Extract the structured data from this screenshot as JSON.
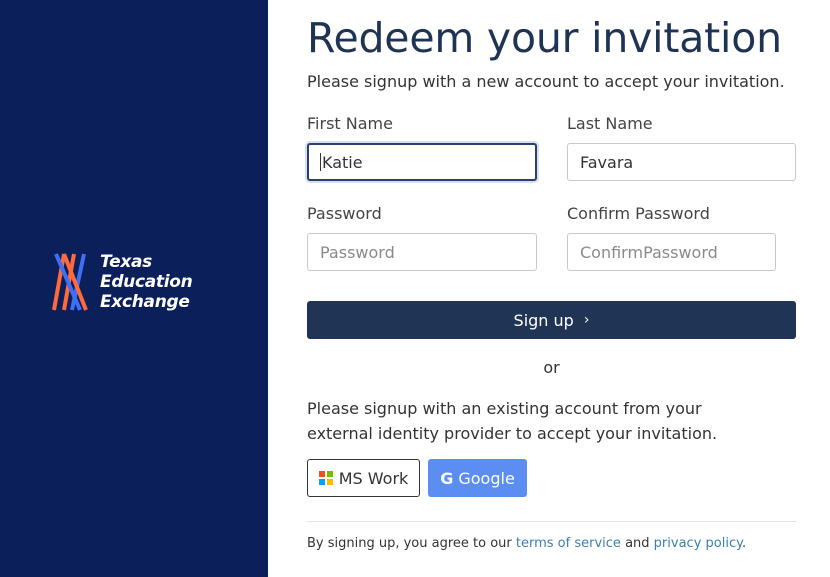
{
  "brand": {
    "line1": "Texas",
    "line2": "Education",
    "line3": "Exchange",
    "sidebar_color": "#0b1f5b"
  },
  "form": {
    "title": "Redeem your invitation",
    "subtitle": "Please signup with a new account to accept your invitation.",
    "first_name": {
      "label": "First Name",
      "value": "Katie"
    },
    "last_name": {
      "label": "Last Name",
      "value": "Favara"
    },
    "password": {
      "label": "Password",
      "placeholder": "Password"
    },
    "confirm_password": {
      "label": "Confirm Password",
      "placeholder": "ConfirmPassword"
    },
    "signup_label": "Sign up",
    "signup_icon": "chevron-right-icon"
  },
  "external": {
    "or_text": "or",
    "description": "Please signup with an existing account from your external identity provider to accept your invitation.",
    "ms_label": "MS Work",
    "google_label": "Google",
    "google_icon": "G"
  },
  "footer": {
    "prefix": "By signing up, you agree to our",
    "terms_link": "terms of service",
    "and": "and",
    "privacy_link": "privacy policy",
    "suffix": "."
  },
  "colors": {
    "accent": "#203455",
    "google": "#5b8ef0",
    "link": "#3c7fb0"
  }
}
